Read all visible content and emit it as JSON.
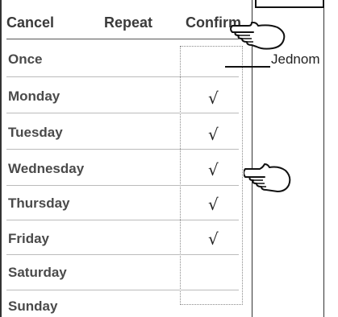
{
  "header": {
    "cancel_label": "Cancel",
    "title": "Repeat",
    "confirm_label": "Confirm"
  },
  "rows": [
    {
      "label": "Once",
      "checked": false
    },
    {
      "label": "Monday",
      "checked": true
    },
    {
      "label": "Tuesday",
      "checked": true
    },
    {
      "label": "Wednesday",
      "checked": true
    },
    {
      "label": "Thursday",
      "checked": true
    },
    {
      "label": "Friday",
      "checked": true
    },
    {
      "label": "Saturday",
      "checked": false
    },
    {
      "label": "Sunday",
      "checked": false
    }
  ],
  "check_glyph": "√",
  "annotation": {
    "label": "Jednom"
  },
  "icons": [
    "pointing-hand-icon"
  ]
}
